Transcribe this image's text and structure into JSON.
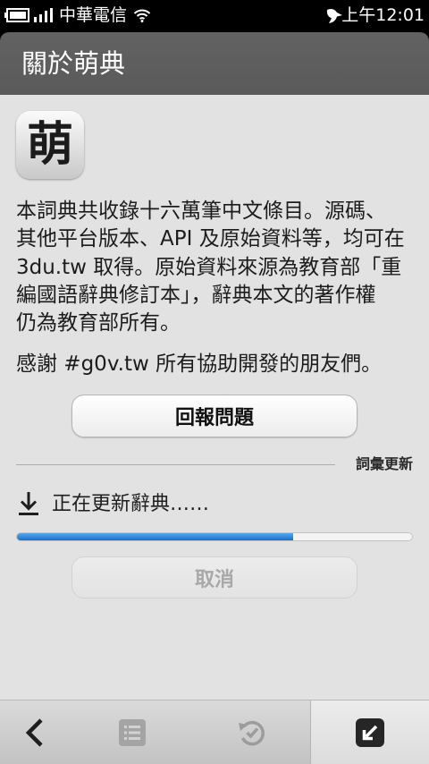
{
  "status_bar": {
    "carrier": "中華電信",
    "time": "上午12:01",
    "icons": [
      "battery-icon",
      "signal-icon",
      "wifi-icon",
      "notification-icon"
    ]
  },
  "header": {
    "title": "關於萌典"
  },
  "app_icon": {
    "glyph": "萌",
    "icon": "app-logo-icon"
  },
  "about": {
    "lines": [
      "本詞典共收錄十六萬筆中文條目。源碼、",
      "其他平台版本、API 及原始資料等，均可在",
      "3du.tw 取得。原始資料來源為教育部「重",
      "編國語辭典修訂本」，辭典本文的著作權",
      "仍為教育部所有。"
    ],
    "thanks": "感謝 #g0v.tw 所有協助開發的朋友們。",
    "report_button": "回報問題"
  },
  "update": {
    "section_label": "詞彙更新",
    "status_icon": "download-icon",
    "status": "正在更新辭典……",
    "progress": 0.7,
    "cancel_button": "取消",
    "cancel_enabled": false
  },
  "toolbar": {
    "items": [
      {
        "icon": "back-icon",
        "enabled": true
      },
      {
        "icon": "list-icon",
        "enabled": false
      },
      {
        "icon": "history-icon",
        "enabled": false
      },
      {
        "icon": "minimize-icon",
        "enabled": true
      }
    ]
  },
  "colors": {
    "header_bg": "#5a5a5a",
    "content_bg": "#e2e2e2",
    "progress_fill": "#2f86dc",
    "disabled_text": "#a8a8a8"
  }
}
